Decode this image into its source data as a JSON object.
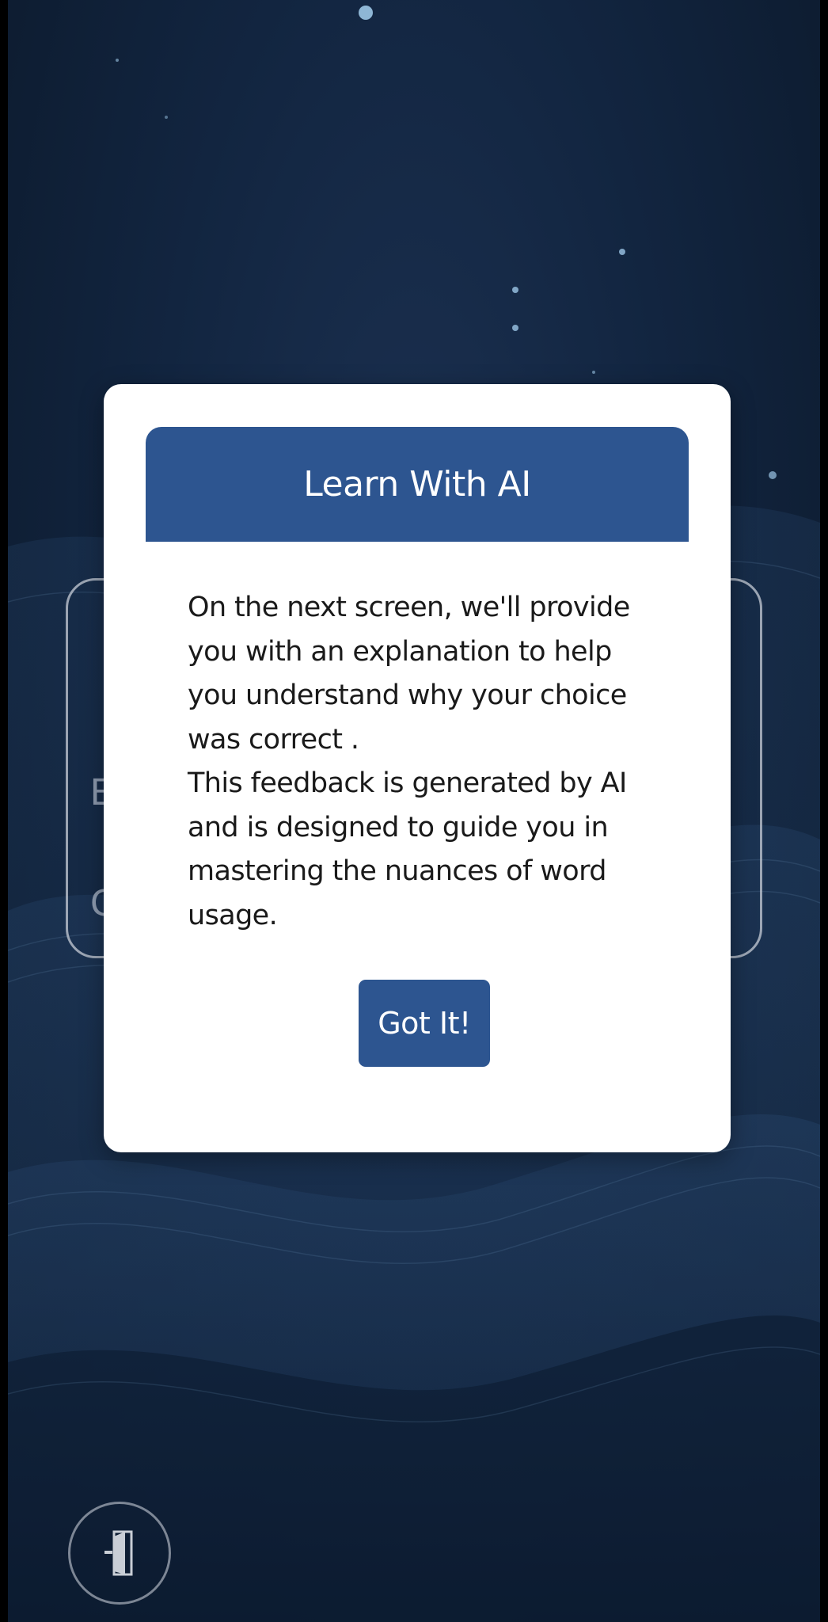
{
  "modal": {
    "title": "Learn With AI",
    "paragraphs": [
      "On the next screen, we'll provide you with an explanation to help you understand why your choice was correct .",
      "This feedback is generated by AI and is designed to guide you in mastering the nuances of word usage."
    ],
    "button_label": "Got It!"
  },
  "background_card": {
    "partial_text_1": "E",
    "partial_text_2": "C"
  },
  "corner_button": {
    "icon": "door-exit-icon"
  },
  "colors": {
    "accent": "#2d5590",
    "modal_background": "#ffffff",
    "text": "#1a1a1a",
    "screen_background": "#122540"
  }
}
